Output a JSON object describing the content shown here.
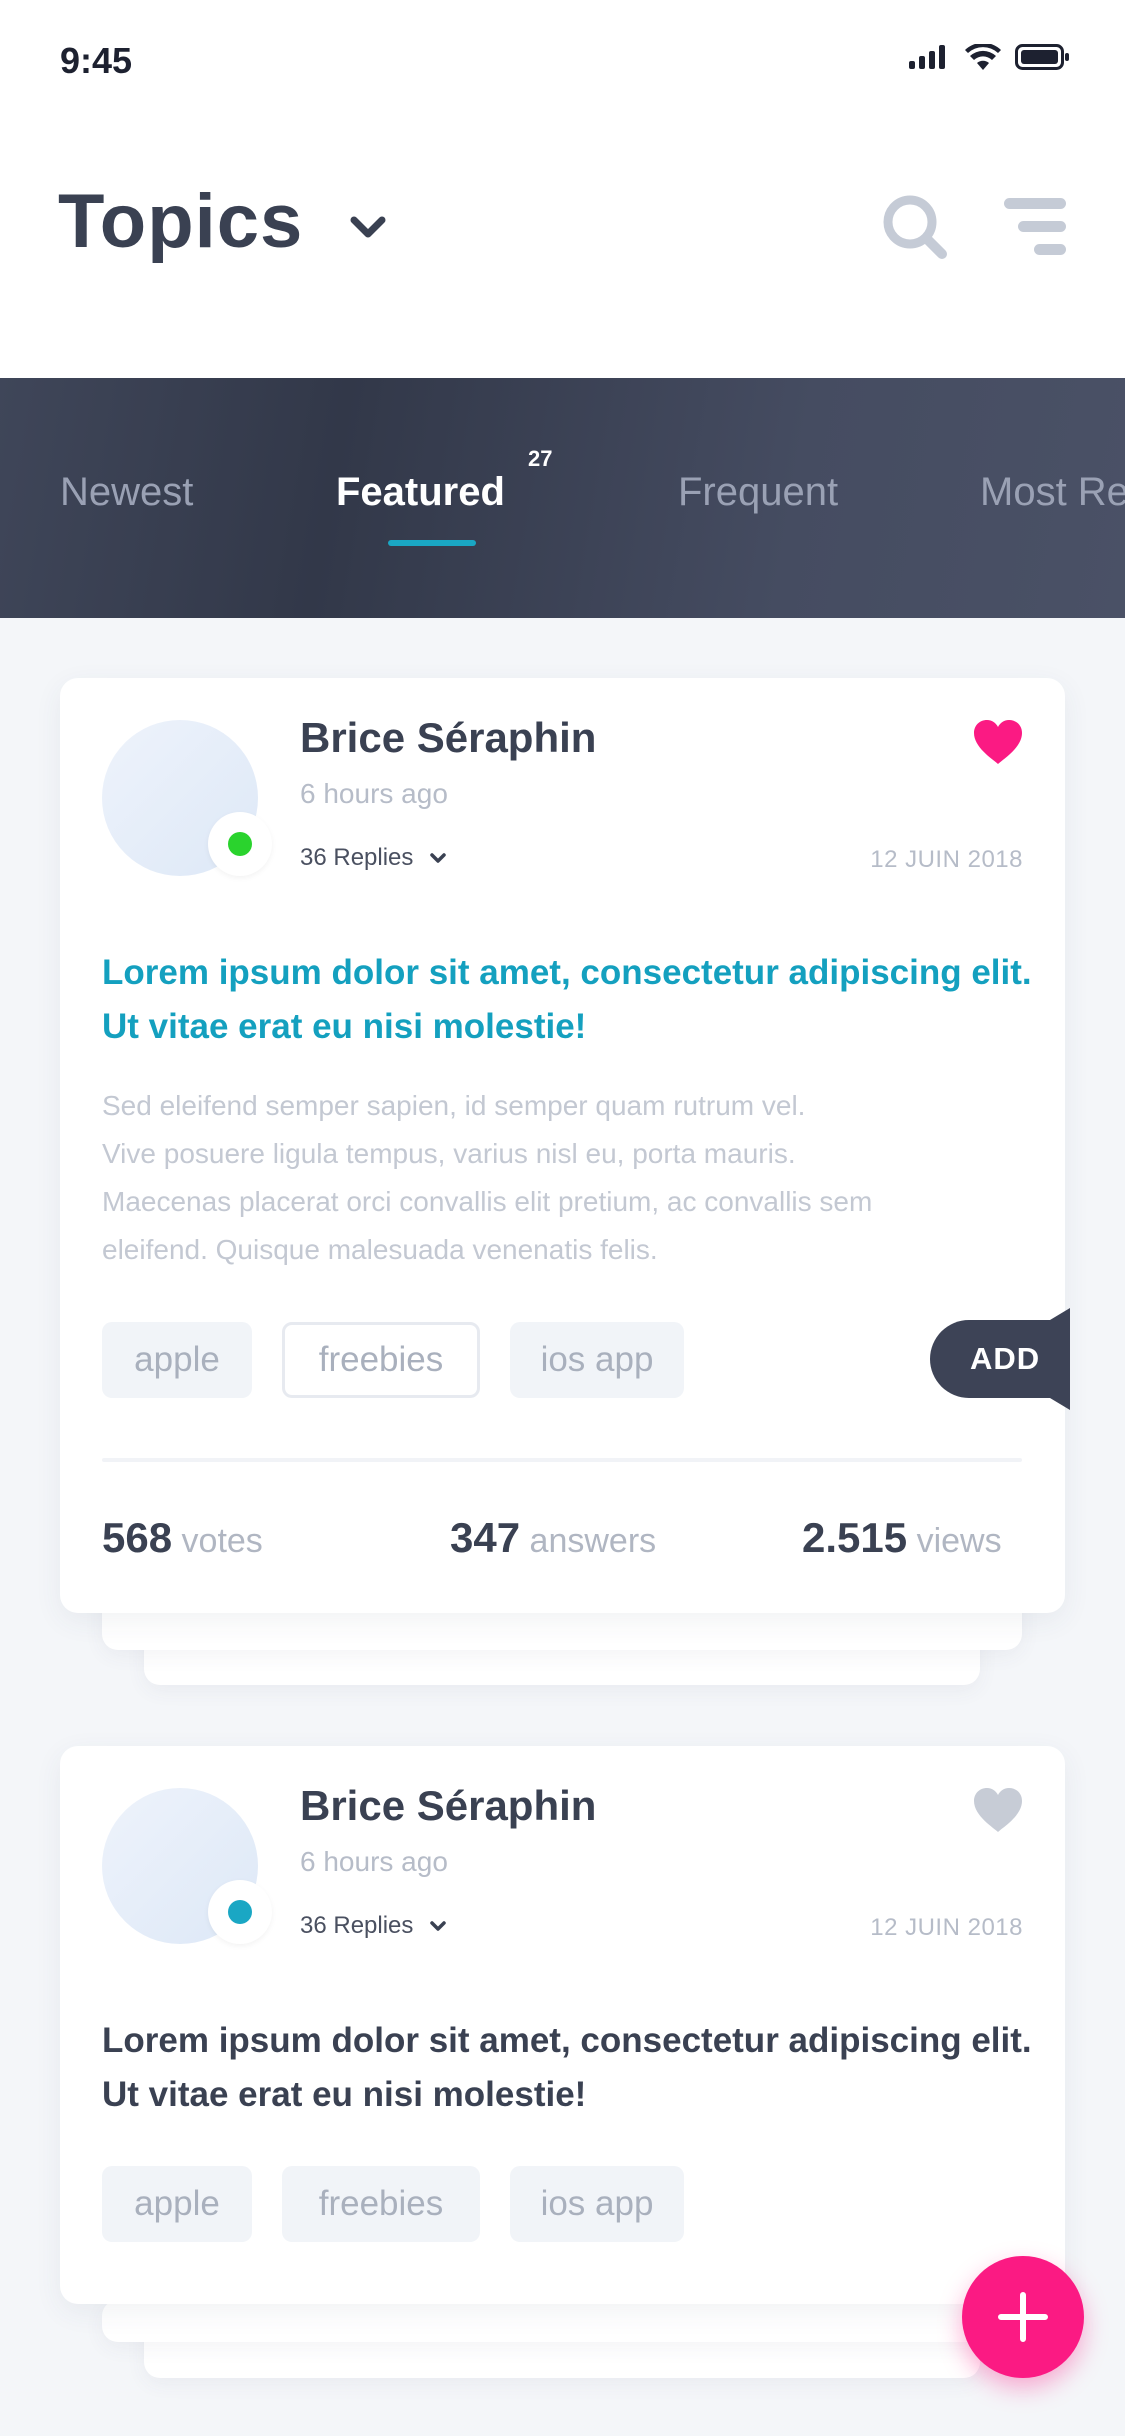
{
  "status_bar": {
    "time": "9:45"
  },
  "header": {
    "title": "Topics"
  },
  "tabs": {
    "items": [
      {
        "label": "Newest"
      },
      {
        "label": "Featured",
        "badge": "27"
      },
      {
        "label": "Frequent"
      },
      {
        "label": "Most Re"
      }
    ],
    "active": "Featured"
  },
  "posts": [
    {
      "author": "Brice Séraphin",
      "time": "6 hours ago",
      "replies": "36 Replies",
      "date": "12 JUIN 2018",
      "liked": true,
      "presence_color": "#2ad32d",
      "headline": "Lorem ipsum dolor sit amet, consectetur adipiscing elit. Ut vitae erat eu nisi molestie!",
      "headline_color": "#14a0bf",
      "body_lines": [
        "Sed eleifend semper sapien, id semper quam rutrum vel.",
        "Vive posuere ligula tempus, varius nisl eu, porta mauris.",
        "Maecenas placerat orci convallis elit pretium, ac convallis sem",
        "eleifend. Quisque malesuada venenatis felis."
      ],
      "tags": [
        "apple",
        "freebies",
        "ios app"
      ],
      "add_label": "ADD",
      "stats": {
        "votes_value": "568",
        "votes_label": "votes",
        "answers_value": "347",
        "answers_label": "answers",
        "views_value": "2.515",
        "views_label": "views"
      }
    },
    {
      "author": "Brice Séraphin",
      "time": "6 hours ago",
      "replies": "36 Replies",
      "date": "12 JUIN 2018",
      "liked": false,
      "presence_color": "#1aa7c4",
      "headline": "Lorem ipsum dolor sit amet, consectetur adipiscing elit. Ut vitae erat eu nisi molestie!",
      "headline_color": "#3a4152",
      "tags": [
        "apple",
        "freebies",
        "ios app"
      ]
    }
  ],
  "colors": {
    "accent": "#1aa7c4",
    "like": "#fb1a83",
    "heart_inactive": "#c7ccd6",
    "dark": "#3a4152"
  },
  "icons": {
    "title_chevron": "chevron-down-icon",
    "search": "search-icon",
    "filter": "filter-icon",
    "heart": "heart-icon",
    "fab": "plus-icon"
  }
}
